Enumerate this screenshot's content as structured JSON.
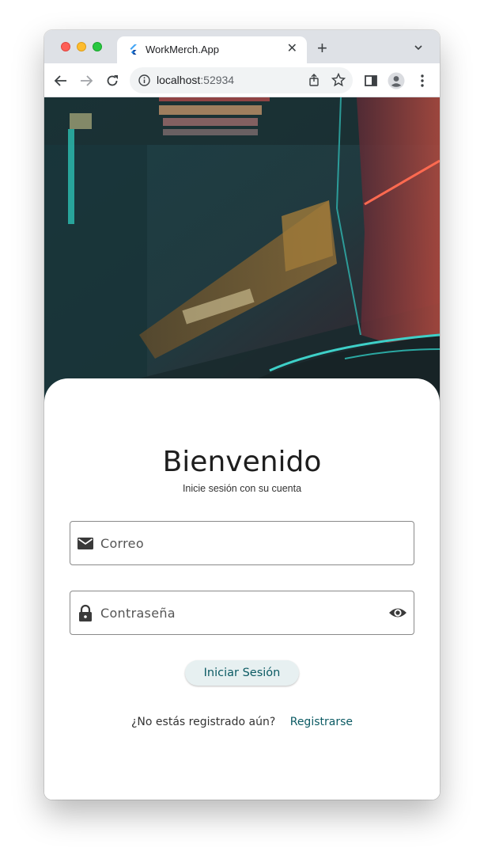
{
  "browser": {
    "tab_title": "WorkMerch.App",
    "tab_close": "✕",
    "new_tab": "+",
    "url_host": "localhost",
    "url_port": ":52934"
  },
  "login": {
    "title": "Bienvenido",
    "subtitle": "Inicie sesión con su cuenta",
    "email_placeholder": "Correo",
    "password_placeholder": "Contraseña",
    "submit_label": "Iniciar Sesión",
    "register_prompt": "¿No estás registrado aún?",
    "register_link": "Registrarse"
  },
  "colors": {
    "accent": "#0b5a63",
    "button_bg": "#e7f0f1",
    "tab_bar": "#dee1e6"
  },
  "icons": {
    "email": "mail-icon",
    "password": "lock-icon",
    "visibility": "eye-icon"
  }
}
